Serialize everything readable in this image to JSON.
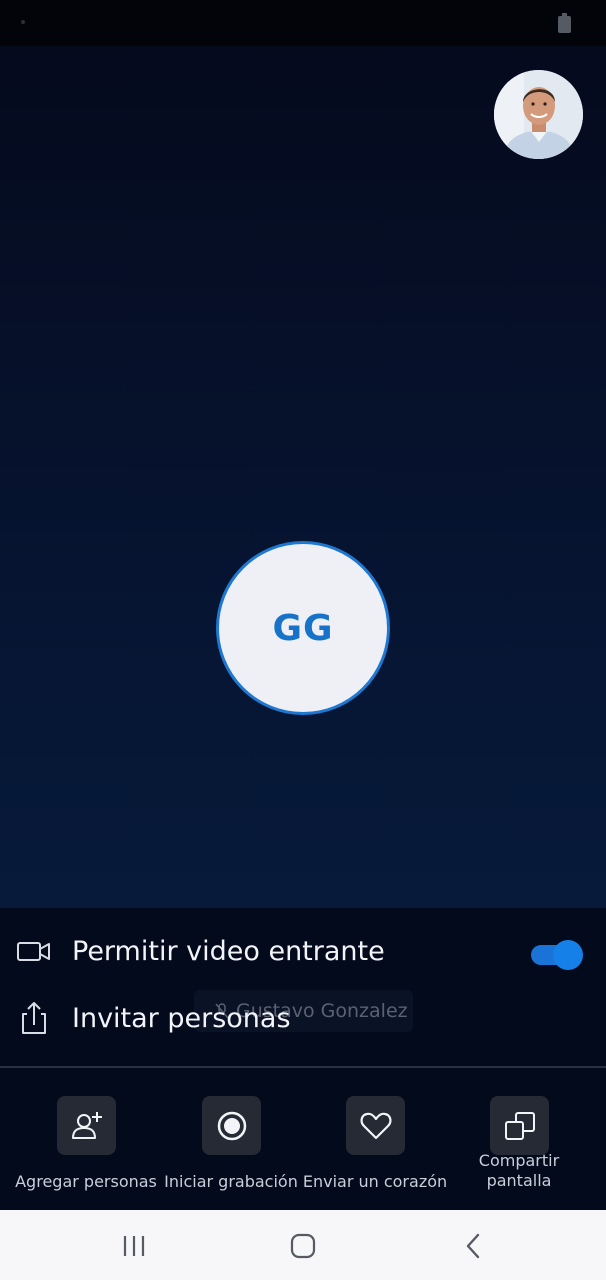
{
  "call": {
    "participant_initials": "GG",
    "participant_name": "Gustavo Gonzalez",
    "accent_color": "#1e78d2"
  },
  "settings": {
    "video_label": "Permitir video entrante",
    "video_enabled": true,
    "invite_label": "Invitar personas"
  },
  "actions": [
    {
      "label": "Agregar personas",
      "icon": "add-person-icon"
    },
    {
      "label": "Iniciar grabación",
      "icon": "record-icon"
    },
    {
      "label": "Enviar un corazón",
      "icon": "heart-icon"
    },
    {
      "label": "Compartir pantalla",
      "icon": "share-screen-icon"
    }
  ],
  "nav": {
    "items": [
      "recents-icon",
      "home-icon",
      "back-icon"
    ]
  }
}
